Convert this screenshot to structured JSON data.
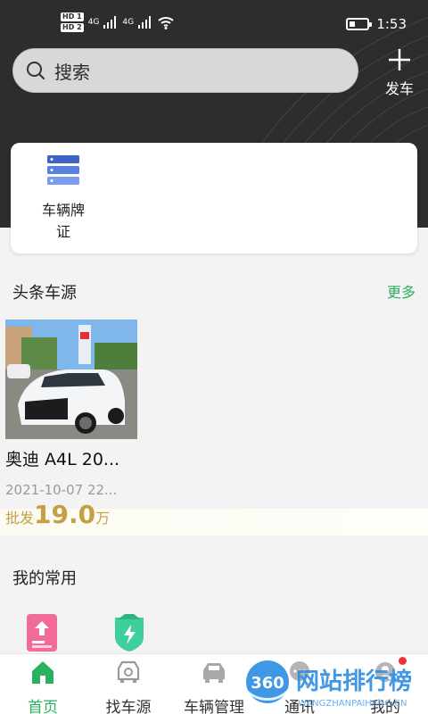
{
  "status_bar": {
    "sim1": "HD 1",
    "sim2": "HD 2",
    "network1": "4G",
    "network2": "4G",
    "time": "1:53"
  },
  "search": {
    "placeholder": "搜索"
  },
  "publish": {
    "label": "发车"
  },
  "quick_card": {
    "items": [
      {
        "label": "车辆牌证",
        "icon": "server-stack-icon"
      }
    ]
  },
  "headline": {
    "title": "头条车源",
    "more": "更多",
    "cars": [
      {
        "title": "奥迪 A4L 20...",
        "date": "2021-10-07 22...",
        "price_prefix": "批发",
        "price": "19.0",
        "price_unit": "万",
        "image": "white-audi-photo"
      }
    ]
  },
  "common": {
    "title": "我的常用",
    "shortcuts": [
      "upload-doc-icon",
      "green-car-shield-icon"
    ]
  },
  "tabbar": {
    "tabs": [
      {
        "label": "首页",
        "icon": "home-icon",
        "active": true
      },
      {
        "label": "找车源",
        "icon": "car-search-icon",
        "active": false
      },
      {
        "label": "车辆管理",
        "icon": "car-icon",
        "active": false
      },
      {
        "label": "通讯",
        "icon": "chat-icon",
        "active": false
      },
      {
        "label": "我的",
        "icon": "profile-icon",
        "active": false
      }
    ]
  },
  "watermark": {
    "brand_number": "360",
    "brand_text": "网站排行榜",
    "url": "WANGZHANPAIHANG.CN"
  },
  "colors": {
    "accent_green": "#2bb062",
    "price_gold": "#c5a043",
    "header_dark": "#2d2d2d"
  }
}
